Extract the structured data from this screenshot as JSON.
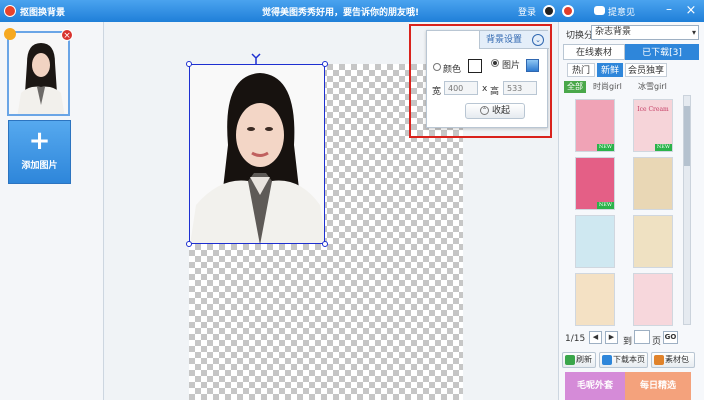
{
  "window": {
    "title": "抠图换背景",
    "slogan": "觉得美图秀秀好用，要告诉你的朋友哦!",
    "login": "登录",
    "feedback": "提意见",
    "minimize": "–",
    "close": "×"
  },
  "left_panel": {
    "thumb_remove": "×",
    "add_photo_plus": "+",
    "add_photo_label": "添加图片"
  },
  "bg_settings": {
    "title": "背景设置",
    "collapse_glyph": "⌄",
    "color_label": "颜色",
    "image_label": "图片",
    "selected": "image",
    "width_label": "宽",
    "width_value": "400",
    "times": "x",
    "height_label": "高",
    "height_value": "533",
    "collapse_button": "收起",
    "collapse_button_glyph": "⌃"
  },
  "right_panel": {
    "switch_category_label": "切换分类",
    "category_selected": "杂志背景",
    "caret": "▾",
    "tab_online": "在线素材",
    "tab_downloaded": "已下载[3]",
    "sub_tabs": [
      "热门",
      "新鲜",
      "会员独享"
    ],
    "active_sub_tab": "新鲜",
    "filters": [
      "全部",
      "时尚girl",
      "冰雪girl"
    ],
    "active_filter": "全部",
    "tiles": [
      {
        "text": "",
        "new": "NEW",
        "bg": "#f0a3b6"
      },
      {
        "text": "Ice Cream",
        "new": "NEW",
        "bg": "#f6d4d9"
      },
      {
        "text": "",
        "new": "NEW",
        "bg": "#e45f86"
      },
      {
        "text": "",
        "new": "",
        "bg": "#e9d7b5"
      },
      {
        "text": "",
        "new": "",
        "bg": "#cfe8f1"
      },
      {
        "text": "",
        "new": "",
        "bg": "#efe1c2"
      },
      {
        "text": "",
        "new": "",
        "bg": "#f4e1c4"
      },
      {
        "text": "",
        "new": "",
        "bg": "#f7d7dc"
      }
    ],
    "pager_text": "1/15",
    "prev_glyph": "◀",
    "next_glyph": "▶",
    "goto_label": "到",
    "page_label": "页",
    "go": "GO",
    "refresh": "刷新",
    "download_page": "下载本页",
    "material_pack": "素材包",
    "promo_left": "毛呢外套",
    "promo_right": "每日精选"
  },
  "colors": {
    "accent": "#2e86da",
    "highlight": "#d9221c",
    "selection": "#1d2fd1"
  }
}
